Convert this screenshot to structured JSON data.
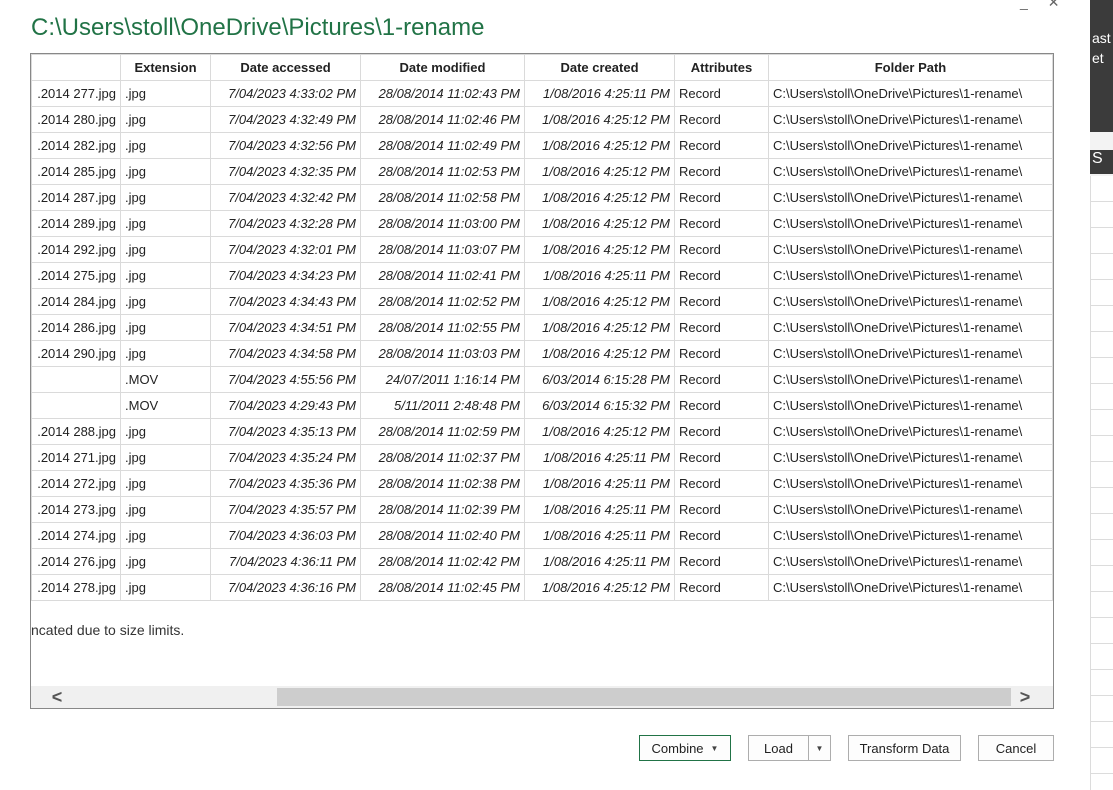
{
  "background": {
    "ribbon_text_1": "ast",
    "ribbon_text_2": "et",
    "column_letter": "S"
  },
  "window_controls": {
    "minimize": "_",
    "close": "✕"
  },
  "dialog": {
    "title": "C:\\Users\\stoll\\OneDrive\\Pictures\\1-rename"
  },
  "table": {
    "columns": [
      "",
      "Extension",
      "Date accessed",
      "Date modified",
      "Date created",
      "Attributes",
      "Folder Path"
    ],
    "rows": [
      [
        ".2014 277.jpg",
        ".jpg",
        "7/04/2023 4:33:02 PM",
        "28/08/2014 11:02:43 PM",
        "1/08/2016 4:25:11 PM",
        "Record",
        "C:\\Users\\stoll\\OneDrive\\Pictures\\1-rename\\"
      ],
      [
        ".2014 280.jpg",
        ".jpg",
        "7/04/2023 4:32:49 PM",
        "28/08/2014 11:02:46 PM",
        "1/08/2016 4:25:12 PM",
        "Record",
        "C:\\Users\\stoll\\OneDrive\\Pictures\\1-rename\\"
      ],
      [
        ".2014 282.jpg",
        ".jpg",
        "7/04/2023 4:32:56 PM",
        "28/08/2014 11:02:49 PM",
        "1/08/2016 4:25:12 PM",
        "Record",
        "C:\\Users\\stoll\\OneDrive\\Pictures\\1-rename\\"
      ],
      [
        ".2014 285.jpg",
        ".jpg",
        "7/04/2023 4:32:35 PM",
        "28/08/2014 11:02:53 PM",
        "1/08/2016 4:25:12 PM",
        "Record",
        "C:\\Users\\stoll\\OneDrive\\Pictures\\1-rename\\"
      ],
      [
        ".2014 287.jpg",
        ".jpg",
        "7/04/2023 4:32:42 PM",
        "28/08/2014 11:02:58 PM",
        "1/08/2016 4:25:12 PM",
        "Record",
        "C:\\Users\\stoll\\OneDrive\\Pictures\\1-rename\\"
      ],
      [
        ".2014 289.jpg",
        ".jpg",
        "7/04/2023 4:32:28 PM",
        "28/08/2014 11:03:00 PM",
        "1/08/2016 4:25:12 PM",
        "Record",
        "C:\\Users\\stoll\\OneDrive\\Pictures\\1-rename\\"
      ],
      [
        ".2014 292.jpg",
        ".jpg",
        "7/04/2023 4:32:01 PM",
        "28/08/2014 11:03:07 PM",
        "1/08/2016 4:25:12 PM",
        "Record",
        "C:\\Users\\stoll\\OneDrive\\Pictures\\1-rename\\"
      ],
      [
        ".2014 275.jpg",
        ".jpg",
        "7/04/2023 4:34:23 PM",
        "28/08/2014 11:02:41 PM",
        "1/08/2016 4:25:11 PM",
        "Record",
        "C:\\Users\\stoll\\OneDrive\\Pictures\\1-rename\\"
      ],
      [
        ".2014 284.jpg",
        ".jpg",
        "7/04/2023 4:34:43 PM",
        "28/08/2014 11:02:52 PM",
        "1/08/2016 4:25:12 PM",
        "Record",
        "C:\\Users\\stoll\\OneDrive\\Pictures\\1-rename\\"
      ],
      [
        ".2014 286.jpg",
        ".jpg",
        "7/04/2023 4:34:51 PM",
        "28/08/2014 11:02:55 PM",
        "1/08/2016 4:25:12 PM",
        "Record",
        "C:\\Users\\stoll\\OneDrive\\Pictures\\1-rename\\"
      ],
      [
        ".2014 290.jpg",
        ".jpg",
        "7/04/2023 4:34:58 PM",
        "28/08/2014 11:03:03 PM",
        "1/08/2016 4:25:12 PM",
        "Record",
        "C:\\Users\\stoll\\OneDrive\\Pictures\\1-rename\\"
      ],
      [
        "",
        ".MOV",
        "7/04/2023 4:55:56 PM",
        "24/07/2011 1:16:14 PM",
        "6/03/2014 6:15:28 PM",
        "Record",
        "C:\\Users\\stoll\\OneDrive\\Pictures\\1-rename\\"
      ],
      [
        "",
        ".MOV",
        "7/04/2023 4:29:43 PM",
        "5/11/2011 2:48:48 PM",
        "6/03/2014 6:15:32 PM",
        "Record",
        "C:\\Users\\stoll\\OneDrive\\Pictures\\1-rename\\"
      ],
      [
        ".2014 288.jpg",
        ".jpg",
        "7/04/2023 4:35:13 PM",
        "28/08/2014 11:02:59 PM",
        "1/08/2016 4:25:12 PM",
        "Record",
        "C:\\Users\\stoll\\OneDrive\\Pictures\\1-rename\\"
      ],
      [
        ".2014 271.jpg",
        ".jpg",
        "7/04/2023 4:35:24 PM",
        "28/08/2014 11:02:37 PM",
        "1/08/2016 4:25:11 PM",
        "Record",
        "C:\\Users\\stoll\\OneDrive\\Pictures\\1-rename\\"
      ],
      [
        ".2014 272.jpg",
        ".jpg",
        "7/04/2023 4:35:36 PM",
        "28/08/2014 11:02:38 PM",
        "1/08/2016 4:25:11 PM",
        "Record",
        "C:\\Users\\stoll\\OneDrive\\Pictures\\1-rename\\"
      ],
      [
        ".2014 273.jpg",
        ".jpg",
        "7/04/2023 4:35:57 PM",
        "28/08/2014 11:02:39 PM",
        "1/08/2016 4:25:11 PM",
        "Record",
        "C:\\Users\\stoll\\OneDrive\\Pictures\\1-rename\\"
      ],
      [
        ".2014 274.jpg",
        ".jpg",
        "7/04/2023 4:36:03 PM",
        "28/08/2014 11:02:40 PM",
        "1/08/2016 4:25:11 PM",
        "Record",
        "C:\\Users\\stoll\\OneDrive\\Pictures\\1-rename\\"
      ],
      [
        ".2014 276.jpg",
        ".jpg",
        "7/04/2023 4:36:11 PM",
        "28/08/2014 11:02:42 PM",
        "1/08/2016 4:25:11 PM",
        "Record",
        "C:\\Users\\stoll\\OneDrive\\Pictures\\1-rename\\"
      ],
      [
        ".2014 278.jpg",
        ".jpg",
        "7/04/2023 4:36:16 PM",
        "28/08/2014 11:02:45 PM",
        "1/08/2016 4:25:12 PM",
        "Record",
        "C:\\Users\\stoll\\OneDrive\\Pictures\\1-rename\\"
      ]
    ],
    "truncation_note": "ncated due to size limits."
  },
  "scrollbar": {
    "left_arrow": "<",
    "right_arrow": ">"
  },
  "buttons": {
    "combine": "Combine",
    "combine_caret": "▼",
    "load": "Load",
    "load_caret": "▼",
    "transform": "Transform Data",
    "cancel": "Cancel"
  },
  "colors": {
    "title": "#217346",
    "combine_border": "#217346"
  }
}
